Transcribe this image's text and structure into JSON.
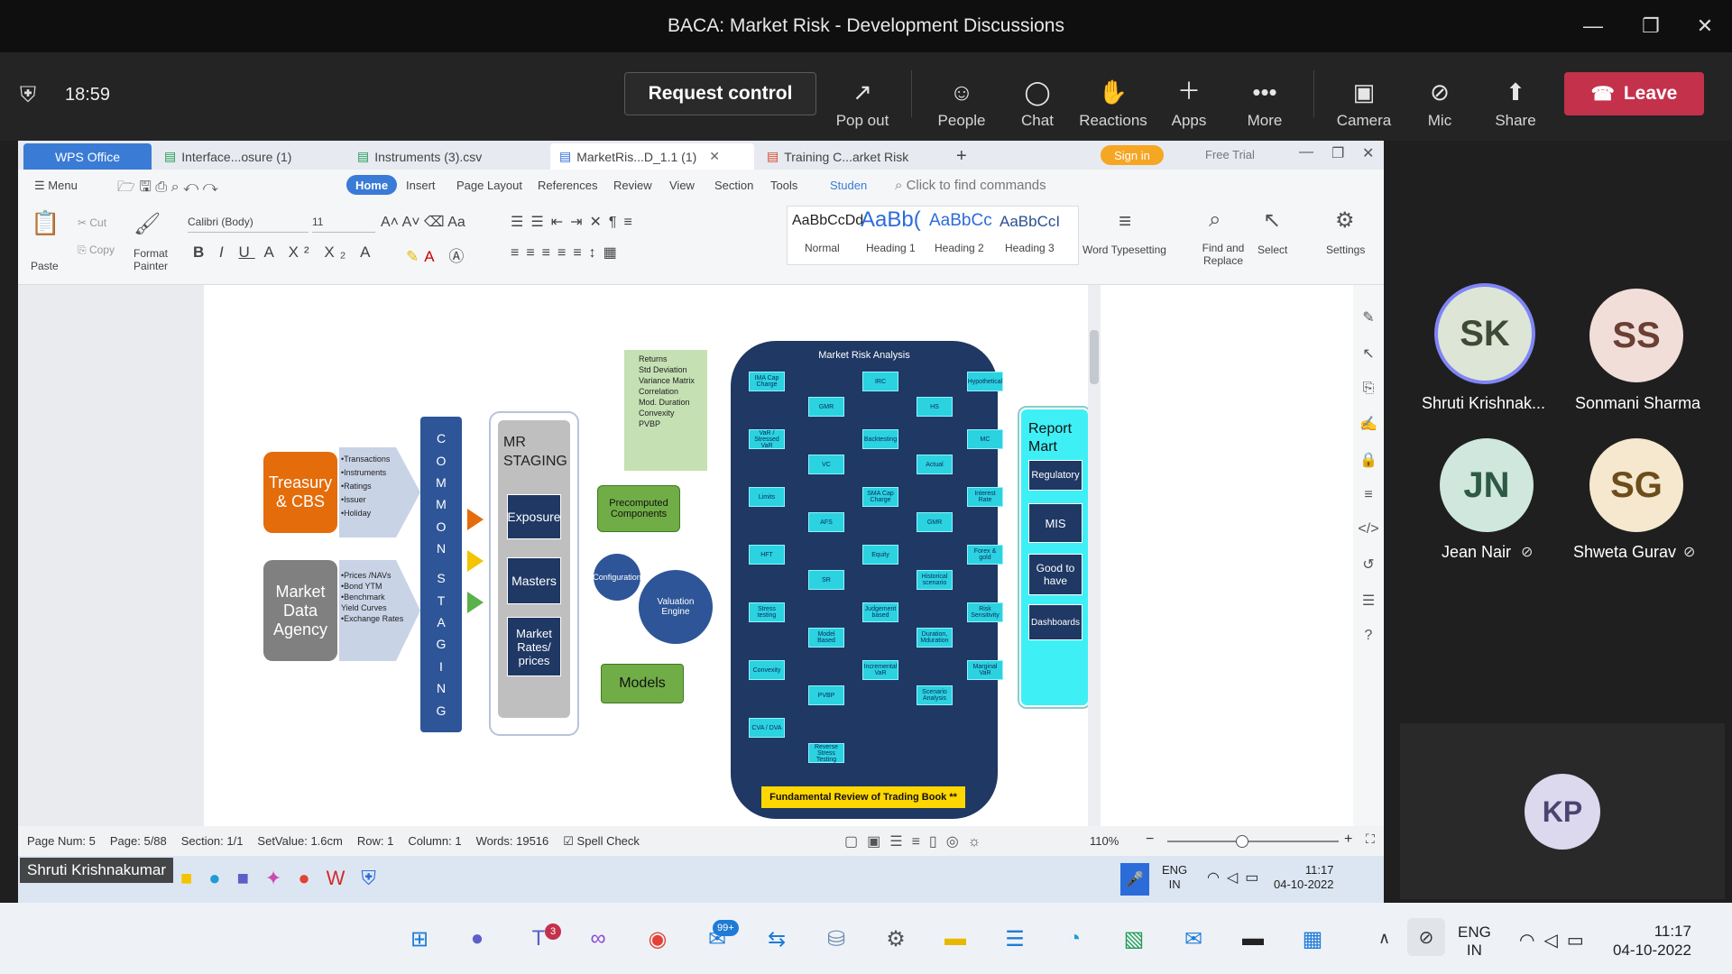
{
  "window": {
    "title": "BACA: Market Risk - Development Discussions"
  },
  "meeting": {
    "time": "18:59",
    "request_control": "Request control",
    "tools": [
      {
        "label": "Pop out",
        "icon": "popout-icon"
      },
      {
        "label": "People",
        "icon": "people-icon"
      },
      {
        "label": "Chat",
        "icon": "chat-icon"
      },
      {
        "label": "Reactions",
        "icon": "reactions-icon"
      },
      {
        "label": "Apps",
        "icon": "plus-icon"
      },
      {
        "label": "More",
        "icon": "more-icon"
      },
      {
        "label": "Camera",
        "icon": "camera-off-icon"
      },
      {
        "label": "Mic",
        "icon": "mic-off-icon"
      },
      {
        "label": "Share",
        "icon": "share-icon"
      }
    ],
    "leave": "Leave",
    "presenter": "Shruti Krishnakumar"
  },
  "participants": [
    {
      "initials": "SK",
      "name": "Shruti Krishnak...",
      "bg": "#dde6d6",
      "fg": "#3d4a35"
    },
    {
      "initials": "SS",
      "name": "Sonmani Sharma",
      "bg": "#f1ded8",
      "fg": "#6b3f33"
    },
    {
      "initials": "JN",
      "name": "Jean Nair",
      "bg": "#cfe7dc",
      "fg": "#2d5a45"
    },
    {
      "initials": "SG",
      "name": "Shweta Gurav",
      "bg": "#f5e8cf",
      "fg": "#6d4c1c"
    },
    {
      "initials": "KP",
      "name": "",
      "bg": "#dcd8ee",
      "fg": "#4a4470"
    }
  ],
  "wps": {
    "tabs": [
      "WPS Office",
      "Interface...osure (1)",
      "Instruments (3).csv",
      "MarketRis...D_1.1 (1)",
      "Training C...arket Risk"
    ],
    "sign_in": "Sign in",
    "free_trial": "Free Trial",
    "menu": [
      "Menu",
      "Home",
      "Insert",
      "Page Layout",
      "References",
      "Review",
      "View",
      "Section",
      "Tools",
      "Studen"
    ],
    "find_commands": "Click to find commands",
    "clipboard": {
      "paste": "Paste",
      "cut": "Cut",
      "copy": "Copy",
      "format_painter": "Format Painter"
    },
    "font": {
      "name": "Calibri (Body)",
      "size": "11"
    },
    "styles": [
      {
        "preview": "AaBbCcDd",
        "label": "Normal"
      },
      {
        "preview": "AaBb(",
        "label": "Heading 1"
      },
      {
        "preview": "AaBbCc",
        "label": "Heading 2"
      },
      {
        "preview": "AaBbCcI",
        "label": "Heading 3"
      }
    ],
    "word_typesetting": "Word Typesetting",
    "find_replace": "Find and Replace",
    "select": "Select",
    "settings": "Settings",
    "status": {
      "page_num": "Page Num: 5",
      "page": "Page: 5/88",
      "section": "Section: 1/1",
      "set_value": "SetValue: 1.6cm",
      "row": "Row: 1",
      "column": "Column: 1",
      "words": "Words: 19516",
      "spell": "Spell Check",
      "zoom": "110%"
    },
    "inner_clock": {
      "lang1": "ENG",
      "lang2": "IN",
      "time": "11:17",
      "date": "04-10-2022"
    }
  },
  "diagram": {
    "treasury": "Treasury & CBS",
    "treasury_items": [
      "•Transactions",
      "•Instruments",
      "•Ratings",
      "•Issuer",
      "•Holiday"
    ],
    "market_data": "Market Data Agency",
    "market_items": [
      "•Prices /NAVs",
      "•Bond YTM",
      "•Benchmark Yield Curves",
      "•Exchange Rates"
    ],
    "common_staging": [
      "C",
      "O",
      "M",
      "M",
      "O",
      "N",
      "",
      "S",
      "T",
      "A",
      "G",
      "I",
      "N",
      "G"
    ],
    "mr_staging": "MR STAGING",
    "staging_boxes": [
      "Exposure",
      "Masters",
      "Market Rates/ prices"
    ],
    "green_list": [
      "Returns",
      "Std Deviation",
      "Variance Matrix",
      "Correlation",
      "Mod. Duration",
      "Convexity",
      "PVBP"
    ],
    "precomputed": "Precomputed Components",
    "config": "Configuration",
    "valuation": "Valuation Engine",
    "models": "Models",
    "mra_title": "Market Risk Analysis",
    "mra_nodes": [
      "IMA Cap Charge",
      "GMR",
      "IRC",
      "HS",
      "Hypothetical",
      "VaR / Stressed VaR",
      "VC",
      "Backtesting",
      "Actual",
      "MC",
      "Limits",
      "AFS",
      "SMA Cap Charge",
      "GMR",
      "Interest Rate",
      "HFT",
      "SR",
      "Equity",
      "Historical scenario",
      "Forex & gold",
      "Stress testing",
      "Model Based",
      "Judgement based",
      "Duration, Mduration",
      "Risk Sensitivity",
      "Convexity",
      "PVBP",
      "Incremental VaR",
      "Scenario Analysis",
      "Marginal VaR",
      "CVA / DVA",
      "Reverse Stress Testing"
    ],
    "frtb": "Fundamental Review of Trading Book **",
    "report_mart": "Report Mart",
    "report_items": [
      "Regulatory",
      "MIS",
      "Good to have",
      "Dashboards"
    ]
  },
  "taskbar": {
    "lang1": "ENG",
    "lang2": "IN",
    "time": "11:17",
    "date": "04-10-2022",
    "teams_badge": "3",
    "outlook_badge": "99+"
  }
}
